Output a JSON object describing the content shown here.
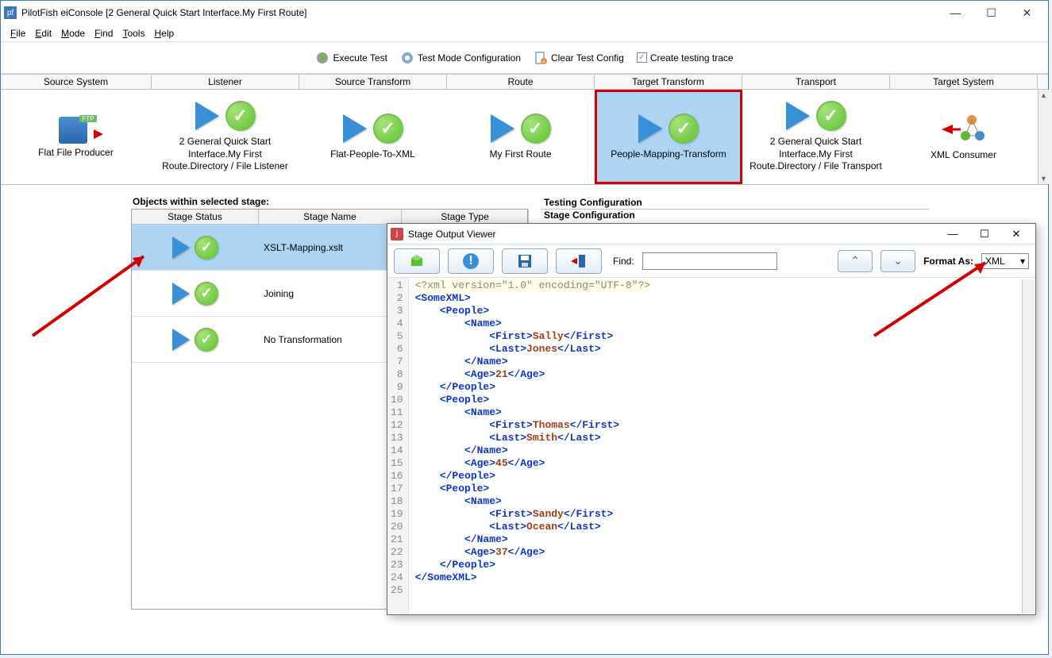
{
  "window": {
    "title": "PilotFish eiConsole [2 General Quick Start Interface.My First Route]"
  },
  "menu": {
    "file": "File",
    "edit": "Edit",
    "mode": "Mode",
    "find": "Find",
    "tools": "Tools",
    "help": "Help"
  },
  "toolbar": {
    "execute_test": "Execute Test",
    "test_mode_config": "Test Mode Configuration",
    "clear_test_config": "Clear Test Config",
    "create_testing_trace": "Create testing trace"
  },
  "pipeline": {
    "headers": {
      "source_system": "Source System",
      "listener": "Listener",
      "source_transform": "Source Transform",
      "route": "Route",
      "target_transform": "Target Transform",
      "transport": "Transport",
      "target_system": "Target System"
    },
    "stages": {
      "source_system": "Flat File Producer",
      "listener": "2 General Quick Start Interface.My First Route.Directory / File Listener",
      "source_transform": "Flat-People-To-XML",
      "route": "My First Route",
      "target_transform": "People-Mapping-Transform",
      "transport": "2 General Quick Start Interface.My First Route.Directory / File Transport",
      "target_system": "XML Consumer"
    }
  },
  "objects_panel": {
    "label": "Objects within selected stage:",
    "headers": {
      "status": "Stage Status",
      "name": "Stage Name",
      "type": "Stage Type"
    },
    "rows": [
      {
        "name": "XSLT-Mapping.xslt"
      },
      {
        "name": "Joining"
      },
      {
        "name": "No Transformation"
      }
    ]
  },
  "right_panel": {
    "testing_config": "Testing Configuration",
    "stage_config": "Stage Configuration"
  },
  "viewer": {
    "title": "Stage Output Viewer",
    "find_label": "Find:",
    "format_label": "Format As:",
    "format_value": "XML",
    "code_lines": [
      {
        "n": 1,
        "kind": "decl",
        "text": "<?xml version=\"1.0\" encoding=\"UTF-8\"?>"
      },
      {
        "n": 2,
        "kind": "open",
        "tag": "SomeXML",
        "indent": 0
      },
      {
        "n": 3,
        "kind": "open",
        "tag": "People",
        "indent": 1
      },
      {
        "n": 4,
        "kind": "open",
        "tag": "Name",
        "indent": 2
      },
      {
        "n": 5,
        "kind": "leaf",
        "tag": "First",
        "val": "Sally",
        "indent": 3
      },
      {
        "n": 6,
        "kind": "leaf",
        "tag": "Last",
        "val": "Jones",
        "indent": 3
      },
      {
        "n": 7,
        "kind": "close",
        "tag": "Name",
        "indent": 2
      },
      {
        "n": 8,
        "kind": "leaf",
        "tag": "Age",
        "val": "21",
        "indent": 2
      },
      {
        "n": 9,
        "kind": "close",
        "tag": "People",
        "indent": 1
      },
      {
        "n": 10,
        "kind": "open",
        "tag": "People",
        "indent": 1
      },
      {
        "n": 11,
        "kind": "open",
        "tag": "Name",
        "indent": 2
      },
      {
        "n": 12,
        "kind": "leaf",
        "tag": "First",
        "val": "Thomas",
        "indent": 3
      },
      {
        "n": 13,
        "kind": "leaf",
        "tag": "Last",
        "val": "Smith",
        "indent": 3
      },
      {
        "n": 14,
        "kind": "close",
        "tag": "Name",
        "indent": 2
      },
      {
        "n": 15,
        "kind": "leaf",
        "tag": "Age",
        "val": "45",
        "indent": 2
      },
      {
        "n": 16,
        "kind": "close",
        "tag": "People",
        "indent": 1
      },
      {
        "n": 17,
        "kind": "open",
        "tag": "People",
        "indent": 1
      },
      {
        "n": 18,
        "kind": "open",
        "tag": "Name",
        "indent": 2
      },
      {
        "n": 19,
        "kind": "leaf",
        "tag": "First",
        "val": "Sandy",
        "indent": 3
      },
      {
        "n": 20,
        "kind": "leaf",
        "tag": "Last",
        "val": "Ocean",
        "indent": 3
      },
      {
        "n": 21,
        "kind": "close",
        "tag": "Name",
        "indent": 2
      },
      {
        "n": 22,
        "kind": "leaf",
        "tag": "Age",
        "val": "37",
        "indent": 2
      },
      {
        "n": 23,
        "kind": "close",
        "tag": "People",
        "indent": 1
      },
      {
        "n": 24,
        "kind": "close",
        "tag": "SomeXML",
        "indent": 0
      },
      {
        "n": 25,
        "kind": "blank"
      }
    ]
  }
}
